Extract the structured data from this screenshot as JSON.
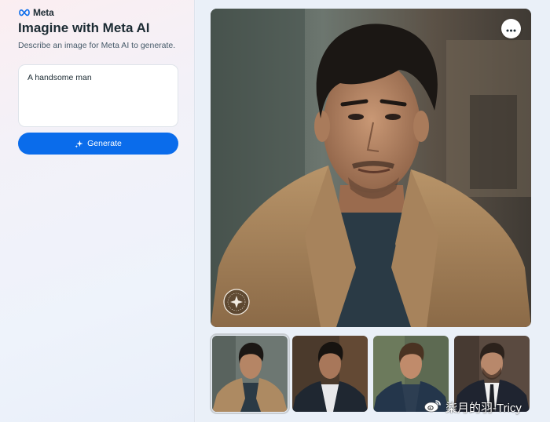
{
  "brand": {
    "name": "Meta",
    "logo_icon": "meta-infinity-icon",
    "color": "#0a6ceb"
  },
  "app": {
    "title": "Imagine with Meta AI",
    "subtitle": "Describe an image for Meta AI to generate."
  },
  "prompt": {
    "value": "A handsome man"
  },
  "generate_button": {
    "label": "Generate",
    "icon": "sparkle-icon"
  },
  "gallery": {
    "main_image": {
      "description_icon": "portrait-image",
      "menu_icon": "more-horizontal-icon"
    },
    "thumbnails": [
      {
        "selected": true
      },
      {
        "selected": false
      },
      {
        "selected": false
      },
      {
        "selected": false
      }
    ]
  },
  "overlay_watermark": {
    "text": "柒月的羽-Tricy",
    "icon": "weibo-icon"
  }
}
